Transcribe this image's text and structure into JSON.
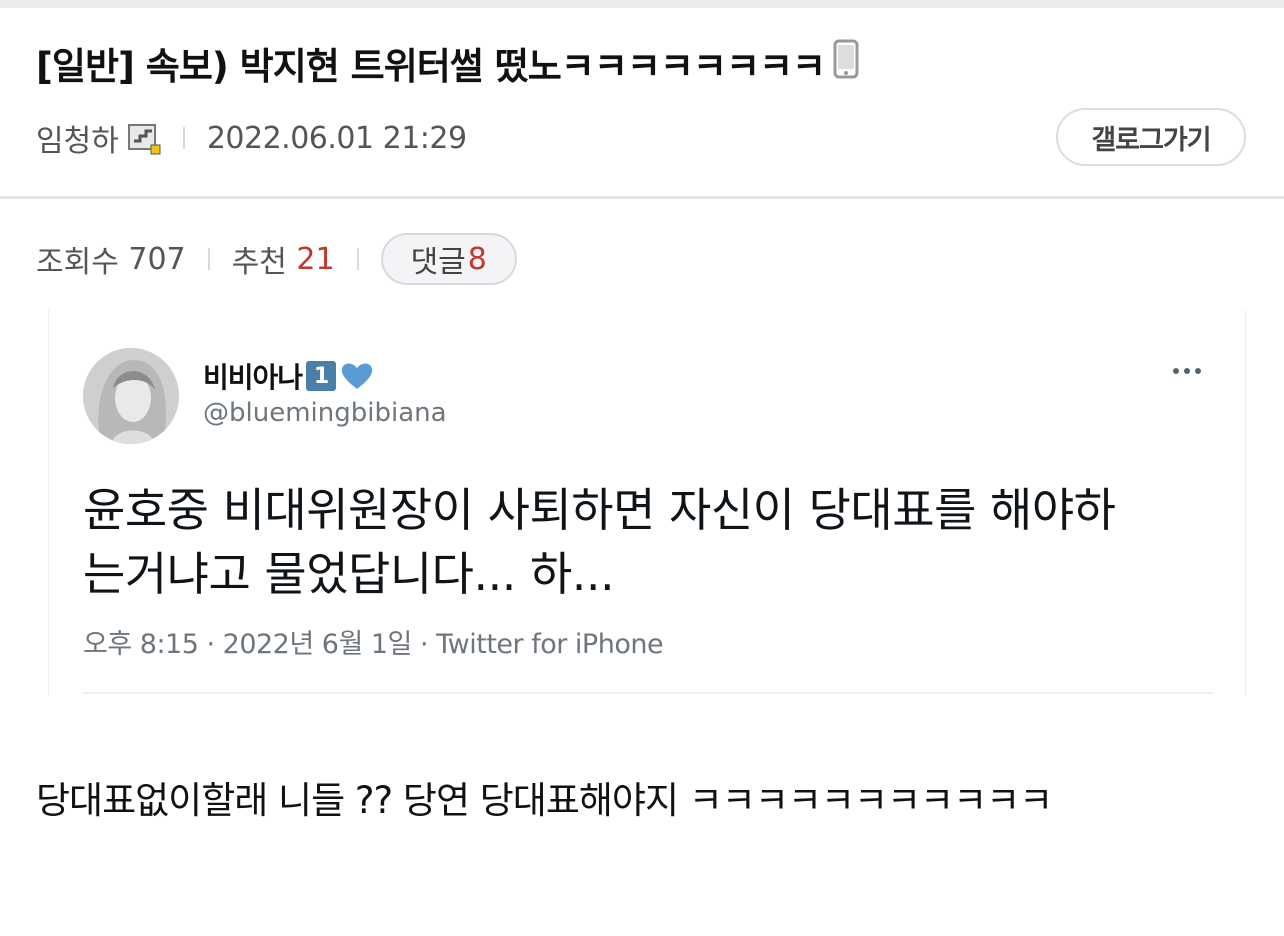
{
  "post": {
    "title": "[일반] 속보) 박지현 트위터썰 떴노ㅋㅋㅋㅋㅋㅋㅋㅋ",
    "author": "임청하",
    "datetime": "2022.06.01 21:29",
    "gallery_button": "갤로그가기",
    "views_label": "조회수",
    "views": "707",
    "recommend_label": "추천",
    "recommend": "21",
    "comments_label": "댓글",
    "comments": "8",
    "body": "당대표없이할래 니들 ?? 당연 당대표해야지 ㅋㅋㅋㅋㅋㅋㅋㅋㅋㅋㅋ"
  },
  "tweet": {
    "name": "비비아나",
    "badge": "1",
    "handle": "@bluemingbibiana",
    "text_line1": "윤호중 비대위원장이 사퇴하면 자신이 당대표를 해야하",
    "text_line2": "는거냐고 물었답니다... 하...",
    "footer": "오후 8:15 · 2022년 6월 1일 · Twitter for iPhone"
  },
  "colors": {
    "accent_red": "#c0392b",
    "badge_blue": "#4a7fa8",
    "heart_blue": "#5b9bd5"
  },
  "icons": [
    "phone-icon",
    "level-icon",
    "verified-heart-icon",
    "more-icon"
  ]
}
